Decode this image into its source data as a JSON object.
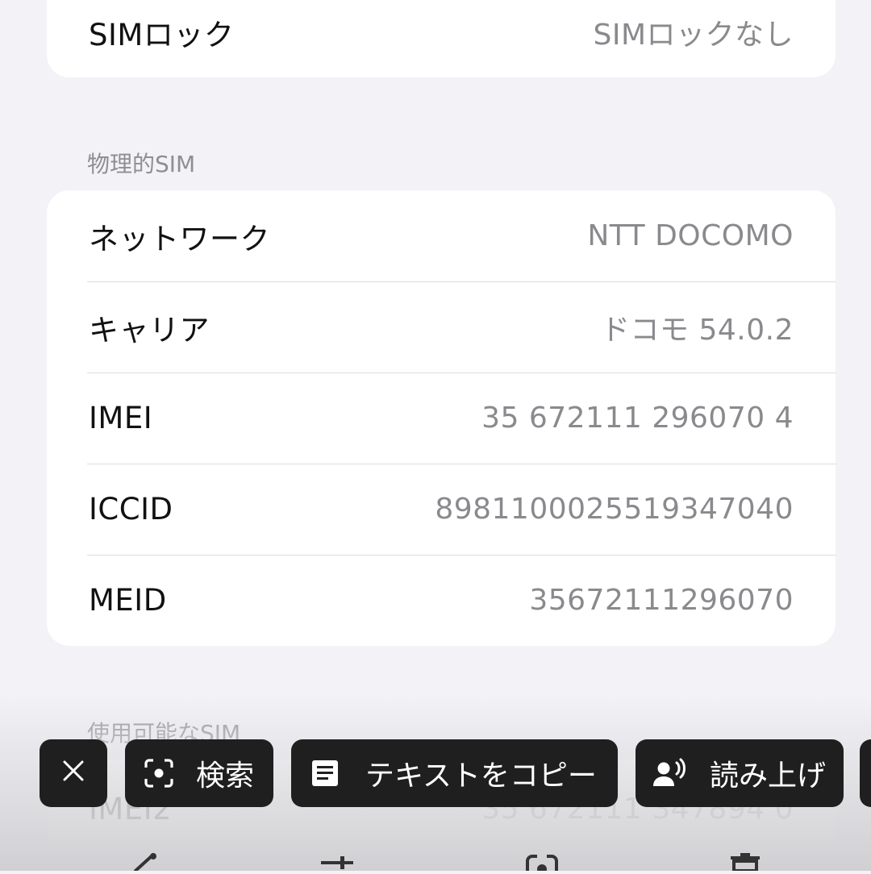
{
  "sim_lock": {
    "label": "SIMロック",
    "value": "SIMロックなし"
  },
  "physical_sim": {
    "header": "物理的SIM",
    "rows": [
      {
        "label": "ネットワーク",
        "value": "NTT DOCOMO"
      },
      {
        "label": "キャリア",
        "value": "ドコモ 54.0.2"
      },
      {
        "label": "IMEI",
        "value": "35 672111 296070 4"
      },
      {
        "label": "ICCID",
        "value": "8981100025519347040"
      },
      {
        "label": "MEID",
        "value": "35672111296070"
      }
    ]
  },
  "available_sim": {
    "header": "使用可能なSIM",
    "rows": [
      {
        "label": "IMEI2",
        "value": "35 672111 347894 0"
      }
    ]
  },
  "lens_toolbar": {
    "search_label": "検索",
    "copy_text_label": "テキストをコピー",
    "read_aloud_label": "読み上げ"
  },
  "icons": {
    "close": "close-icon",
    "lens": "lens-icon",
    "document": "document-icon",
    "speaker": "read-aloud-icon"
  },
  "colors": {
    "chip_bg": "#1f1f1f",
    "value_text": "#8a8a8e",
    "background": "#f2f2f7"
  }
}
